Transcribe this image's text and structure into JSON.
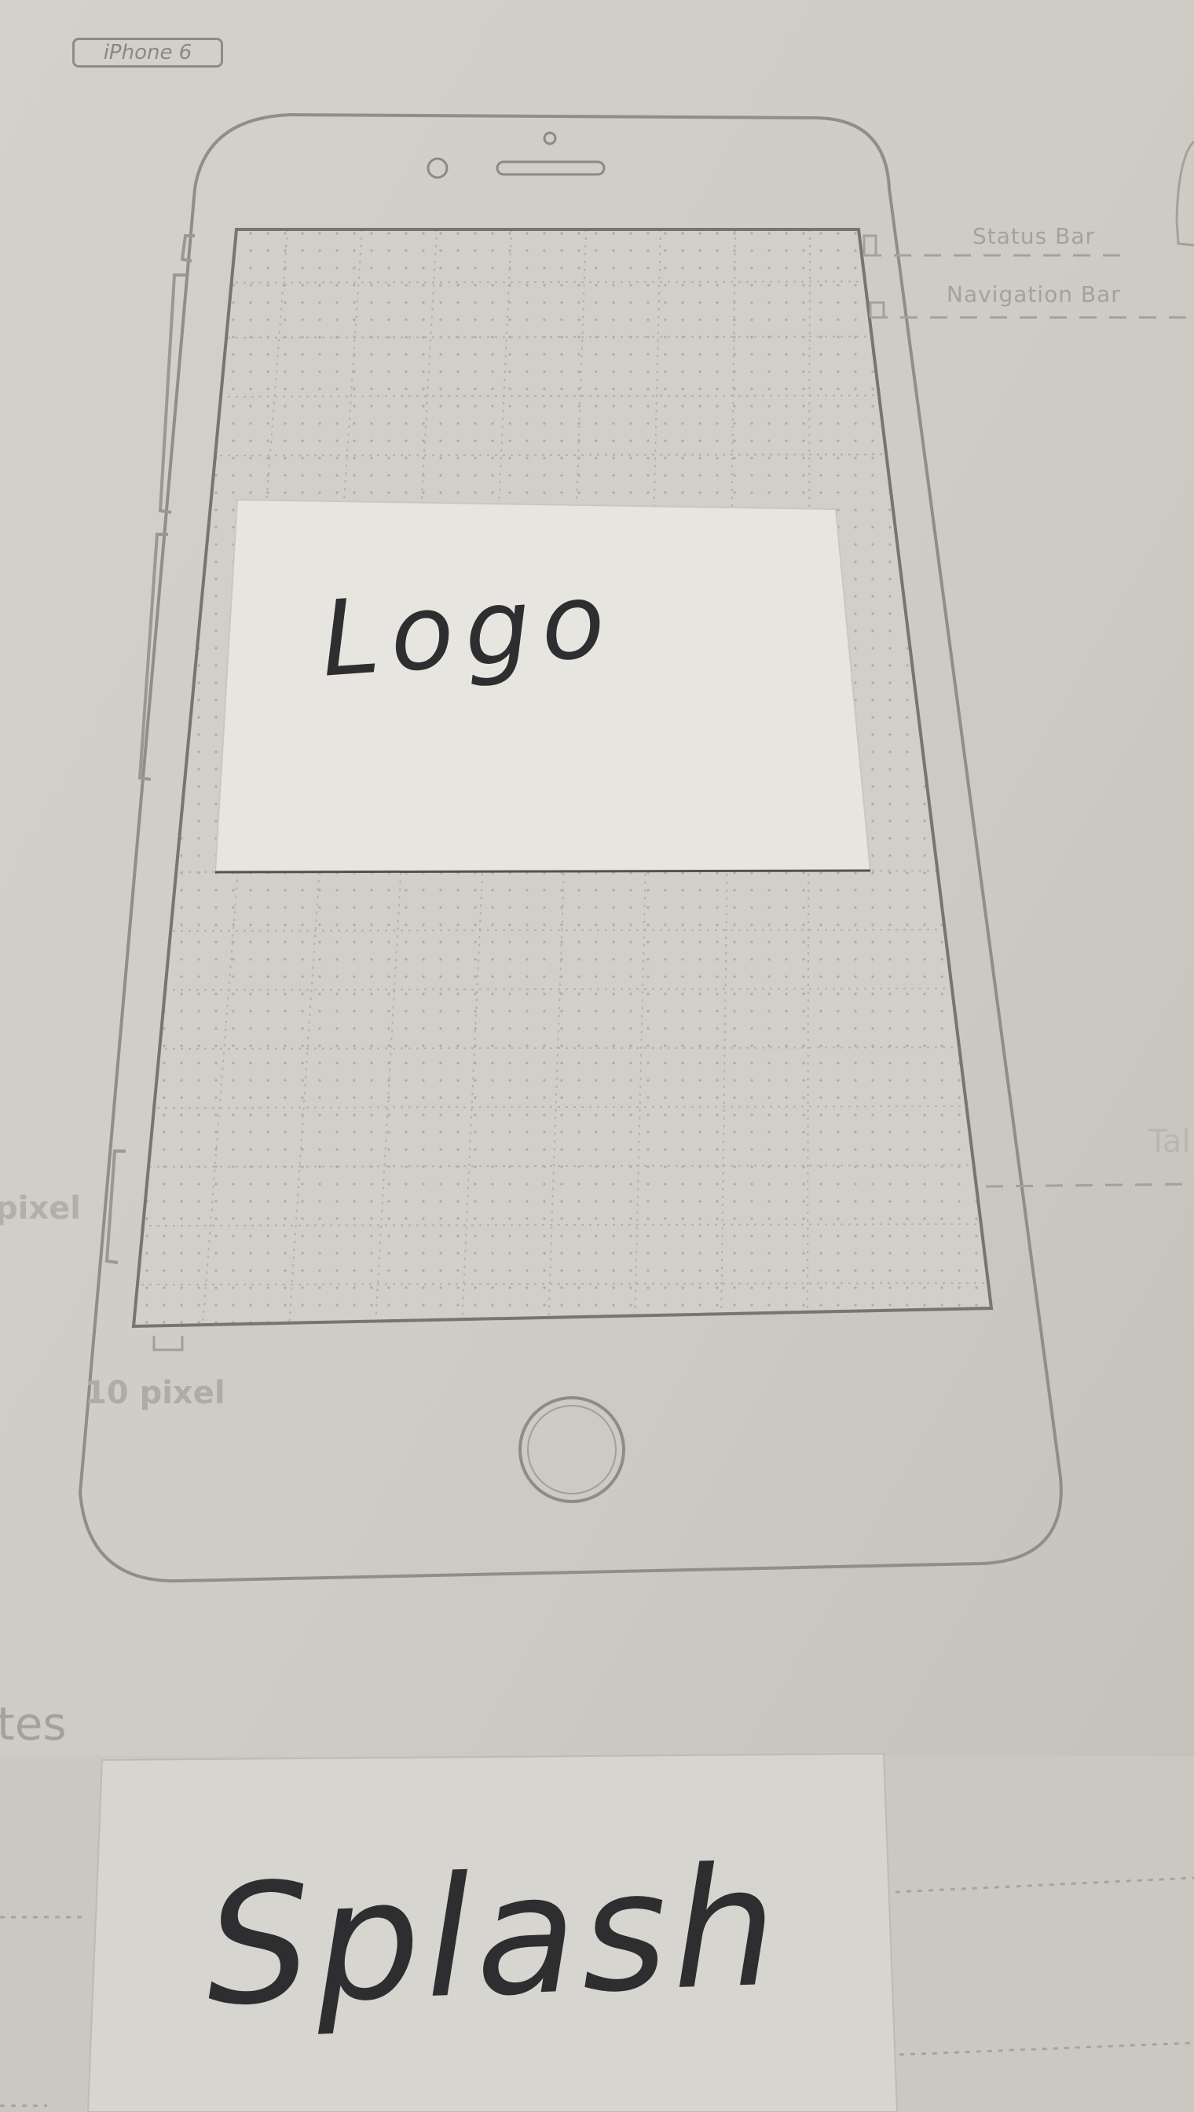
{
  "template": {
    "device_label": "iPhone 6",
    "annotations": {
      "status_bar": "Status Bar",
      "navigation_bar": "Navigation Bar",
      "tab_bar_partial": "Tal",
      "side_margin_partial": "pixel",
      "bottom_margin": "10 pixel"
    },
    "notes_heading_partial": "tes"
  },
  "handwriting": {
    "screen_note": "Logo",
    "notes_text": "Splash"
  },
  "colors": {
    "paper": "#cfcdc5",
    "template_lines": "#8f8d86",
    "grid_dots": "#a9a7a0",
    "sticky_note": "#e6e5df",
    "ink": "#2e2e30"
  },
  "icons": {
    "earpiece": "speaker-slot-icon",
    "camera": "front-camera-icon",
    "home_button": "home-button-icon"
  }
}
